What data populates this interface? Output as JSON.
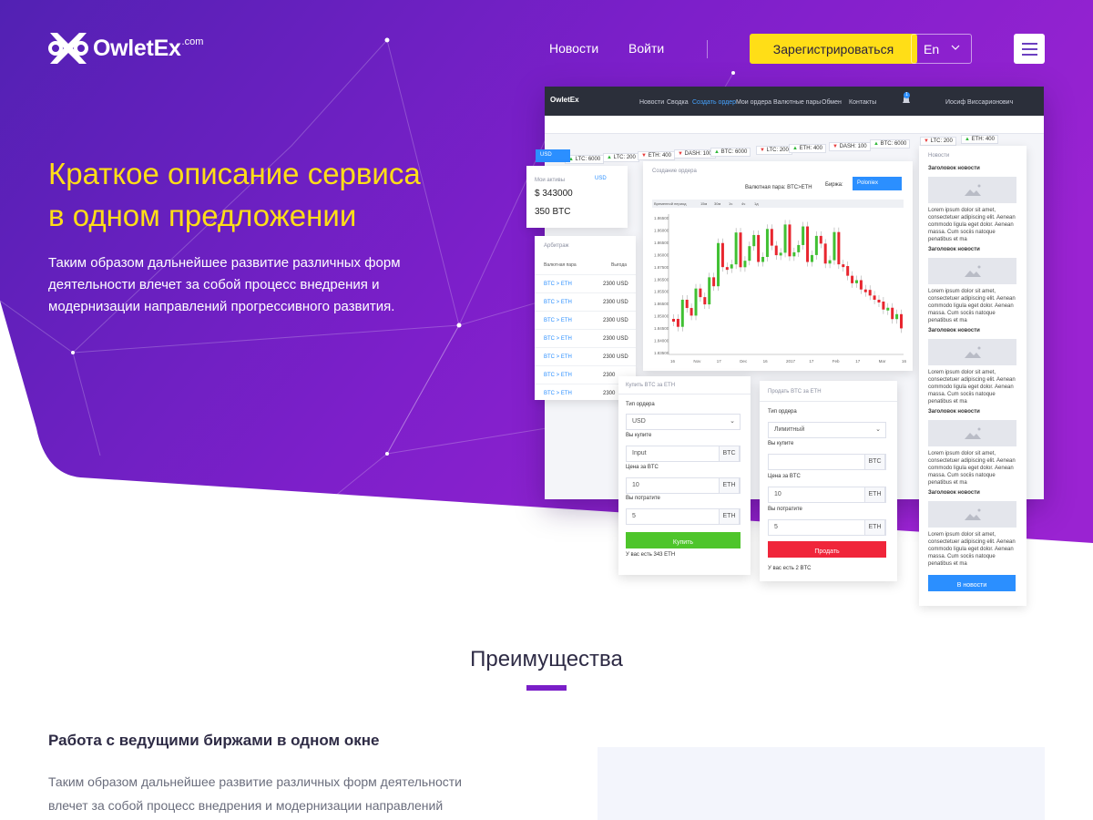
{
  "header": {
    "logo_name": "OwletEx",
    "logo_sup": ".com",
    "nav": [
      {
        "label": "Новости"
      },
      {
        "label": "Войти"
      }
    ],
    "register_label": "Зарегистрироваться",
    "language": "En"
  },
  "hero": {
    "title_line1": "Краткое описание сервиса",
    "title_line2": "в одном предложении",
    "text": "Таким образом дальнейшее развитие различных форм деятельности влечет за собой процесс внедрения и модернизации направлений прогрессивного развития."
  },
  "mockup": {
    "logo": "OwletEx",
    "nav": [
      "Новости",
      "Сводка",
      "Создать ордер",
      "Мои ордера",
      "Валютные пары",
      "Обмен",
      "Контакты"
    ],
    "notifications": "1",
    "user": "Иосиф Виссарионович",
    "ticker": [
      {
        "label": "LTC: 6000",
        "dir": "up"
      },
      {
        "label": "LTC: 200",
        "dir": "up"
      },
      {
        "label": "ETH: 400",
        "dir": "dn"
      },
      {
        "label": "DASH: 100",
        "dir": "dn"
      },
      {
        "label": "BTC: 6000",
        "dir": "up"
      },
      {
        "label": "LTC: 200",
        "dir": "dn"
      },
      {
        "label": "ETH: 400",
        "dir": "up"
      },
      {
        "label": "DASH: 100",
        "dir": "dn"
      },
      {
        "label": "BTC: 6000",
        "dir": "up"
      },
      {
        "label": "LTC: 200",
        "dir": "dn"
      },
      {
        "label": "ETH: 400",
        "dir": "up"
      }
    ],
    "currency": "USD",
    "assets": {
      "title": "Мои активы",
      "currency": "USD",
      "amount1": "$ 343000",
      "amount2": "350 BTC"
    },
    "arbitrage": {
      "title": "Арбитраж",
      "col1": "Валютная пара",
      "col2": "Выгода",
      "rows": [
        {
          "pair": "BTC > ETH",
          "value": "2300 USD"
        },
        {
          "pair": "BTC > ETH",
          "value": "2300 USD"
        },
        {
          "pair": "BTC > ETH",
          "value": "2300 USD"
        },
        {
          "pair": "BTC > ETH",
          "value": "2300 USD"
        },
        {
          "pair": "BTC > ETH",
          "value": "2300 USD"
        },
        {
          "pair": "BTC > ETH",
          "value": "2300"
        },
        {
          "pair": "BTC > ETH",
          "value": "2300"
        }
      ]
    },
    "order": {
      "title": "Создание ордера",
      "pair": "Валютная пара: BTC>ETH",
      "exchange_label": "Биржа:",
      "exchange": "Poloniex",
      "period_label": "Временной период",
      "periods": [
        "15м",
        "30м",
        "1ч",
        "4ч",
        "1д"
      ],
      "y_ticks": [
        "1.86500",
        "1.86000",
        "1.86500",
        "1.86000",
        "1.87500",
        "1.86500",
        "1.85500",
        "1.86500",
        "1.85000",
        "1.84500",
        "1.84000",
        "1.83500"
      ],
      "x_ticks": [
        "16",
        "Nov",
        "17",
        "Dec",
        "16",
        "2017",
        "17",
        "Feb",
        "17",
        "Mar",
        "16"
      ]
    },
    "buy": {
      "title": "Купить BTC за ETH",
      "type_label": "Тип ордера",
      "type_value": "USD",
      "amount_label": "Вы купите",
      "amount_value": "Input",
      "amount_unit": "BTC",
      "price_label": "Цена за BTC",
      "price_value": "10",
      "price_unit": "ETH",
      "spend_label": "Вы потратите",
      "spend_value": "5",
      "spend_unit": "ETH",
      "button": "Купить",
      "balance": "У вас есть 343 ETH"
    },
    "sell": {
      "title": "Продать BTC за ETH",
      "type_label": "Тип ордера",
      "type_value": "Лимитный",
      "amount_label": "Вы купите",
      "amount_unit": "BTC",
      "price_label": "Цена за BTC",
      "price_value": "10",
      "price_unit": "ETH",
      "spend_label": "Вы потратите",
      "spend_value": "5",
      "spend_unit": "ETH",
      "button": "Продать",
      "balance": "У вас есть 2 BTC"
    },
    "news": {
      "title": "Новости",
      "heading": "Заголовок новости",
      "text": "Lorem ipsum dolor sit amet, consectetuer adipiscing elit. Aenean commodo ligula eget dolor. Aenean massa. Cum sociis natoque penatibus et ma",
      "button": "В новости"
    }
  },
  "advantages": {
    "title": "Преимущества",
    "feature_title": "Работа с ведущими биржами в одном окне",
    "feature_text": "Таким образом дальнейшее развитие различных форм деятельности влечет за собой процесс внедрения и модернизации направлений прогрессивного развития. В своей работе вы ..."
  },
  "colors": {
    "accent": "#ffde17",
    "purple_dark": "#5a1fb0",
    "purple": "#8e22d0",
    "blue": "#2b8fff",
    "green": "#4ec52b",
    "red": "#f0253a"
  }
}
